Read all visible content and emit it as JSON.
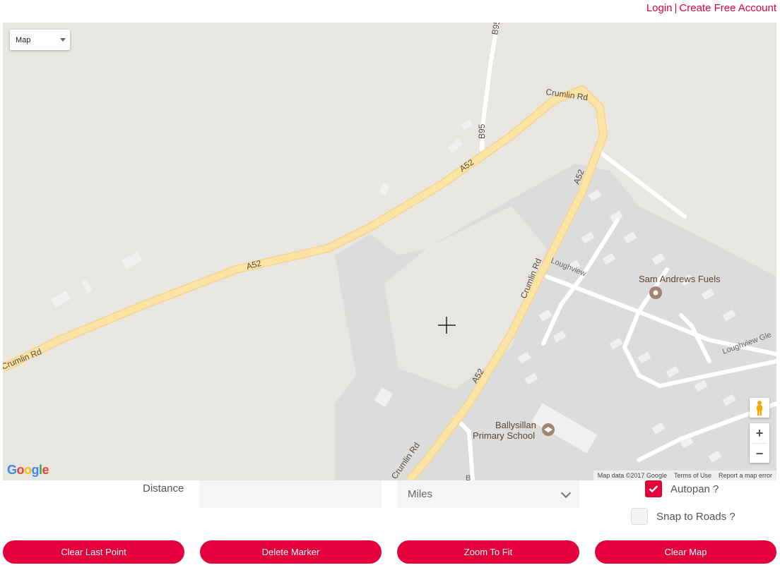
{
  "header": {
    "login": "Login",
    "separator": "|",
    "create_account": "Create Free Account"
  },
  "map": {
    "map_type_label": "Map",
    "labels": {
      "b95_top": "B95",
      "b95": "B95",
      "crumlin_top": "Crumlin Rd",
      "a52_upper": "A52",
      "a52_mid": "A52",
      "a52_left": "A52",
      "crumlin_left": "Crumlin Rd",
      "crumlin_mid": "Crumlin Rd",
      "a52_lower": "A52",
      "crumlin_bottom": "Crumlin Rd",
      "loughview": "Loughview",
      "loughview_glen": "Loughview Gle",
      "sam_andrews": "Sam Andrews Fuels",
      "school_line1": "Ballysillan",
      "school_line2": "Primary School",
      "road_b": "B"
    },
    "logo_letters": [
      "G",
      "o",
      "o",
      "g",
      "l",
      "e"
    ],
    "logo_colors": [
      "#4285F4",
      "#EA4335",
      "#FBBC05",
      "#4285F4",
      "#34A853",
      "#EA4335"
    ],
    "attribution": {
      "map_data": "Map data ©2017 Google",
      "terms": "Terms of Use",
      "report": "Report a map error"
    },
    "zoom_in": "+",
    "zoom_out": "−"
  },
  "form": {
    "distance_label": "Distance",
    "distance_value": "",
    "units_selected": "Miles",
    "autopan_label": "Autopan ?",
    "autopan_checked": true,
    "snap_label": "Snap to Roads ?",
    "snap_checked": false
  },
  "buttons": {
    "clear_last": "Clear Last Point",
    "delete_marker": "Delete Marker",
    "zoom_fit": "Zoom To Fit",
    "clear_map": "Clear Map"
  },
  "colors": {
    "accent": "#e4003b",
    "road_major": "#fce4a6",
    "road_minor": "#ffffff",
    "land": "#e8e6e0",
    "urban": "#dcdcdc"
  }
}
